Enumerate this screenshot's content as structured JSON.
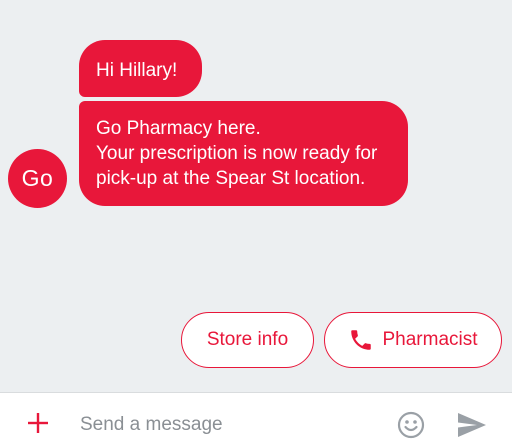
{
  "conversation": {
    "avatar_text": "Go",
    "messages": [
      {
        "lines": [
          "Hi Hillary!"
        ]
      },
      {
        "lines": [
          "Go Pharmacy here.",
          "Your prescription is now ready for",
          "pick-up at the Spear St location."
        ]
      }
    ]
  },
  "suggestions": {
    "store_info": {
      "label": "Store info"
    },
    "pharmacist": {
      "label": "Pharmacist",
      "icon": "phone-icon"
    }
  },
  "composer": {
    "placeholder": "Send a message",
    "add_icon": "plus-icon",
    "emoji_icon": "emoji-icon",
    "send_icon": "send-icon"
  },
  "colors": {
    "brand": "#e8173a",
    "background": "#eceff1",
    "icon_gray": "#9aa0a6"
  }
}
